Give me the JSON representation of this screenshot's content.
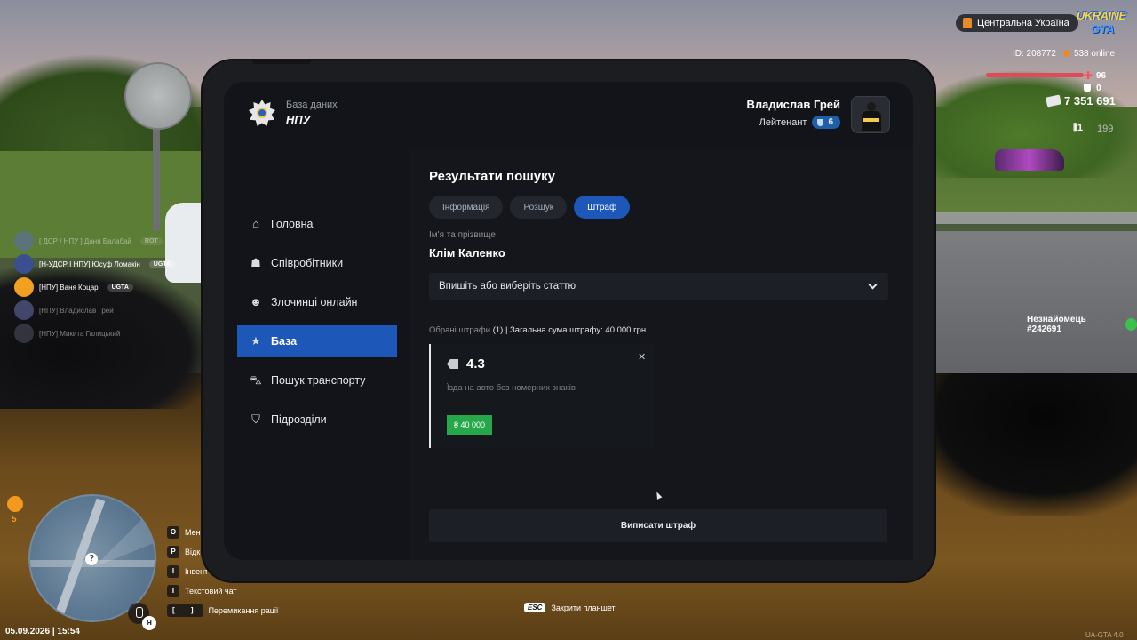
{
  "hud": {
    "region": "Центральна Україна",
    "logo_line1": "UKRAINE",
    "logo_line2": "GTA",
    "player_id": "ID: 208772",
    "online": "538 online",
    "health": "96",
    "armor": "0",
    "money": "7 351 691",
    "ammo_mag": "1",
    "ammo_total": "199",
    "stranger": "Незнайомець #242691",
    "hunger": "5",
    "datetime": "05.09.2026 | 15:54",
    "lang": "Я",
    "version": "UA-GTA 4.0"
  },
  "chat": [
    {
      "text": "[ ДСР / НПУ ] Даня Балабай",
      "badge": "ROT",
      "faded": true
    },
    {
      "text": "[Н-УДСР І НПУ] Юсуф Ломакін",
      "badge": "UGTA",
      "faded": false
    },
    {
      "text": "[НПУ] Ваня Коцар",
      "badge": "UGTA",
      "faded": false
    },
    {
      "text": "[НПУ] Владислав Грей",
      "badge": "",
      "faded": true
    },
    {
      "text": "[НПУ] Микита Галицький",
      "badge": "",
      "faded": true
    }
  ],
  "hotkeys": [
    {
      "key": "O",
      "label": "Мен"
    },
    {
      "key": "P",
      "label": "Відк"
    },
    {
      "key": "I",
      "label": "Інвент"
    },
    {
      "key": "T",
      "label": "Текстовий чат"
    },
    {
      "key": "[ ]",
      "label": "Перемикання рації"
    }
  ],
  "esc_hint": {
    "key": "ESC",
    "label": "Закрити планшет"
  },
  "tablet": {
    "brand_sub": "База даних",
    "brand_title": "НПУ",
    "user_name": "Владислав Грей",
    "user_rank": "Лейтенант",
    "user_rank_level": "6",
    "nav": [
      {
        "label": "Головна",
        "icon": "home-icon",
        "active": false
      },
      {
        "label": "Співробітники",
        "icon": "users-icon",
        "active": false
      },
      {
        "label": "Злочинці онлайн",
        "icon": "criminal-icon",
        "active": false
      },
      {
        "label": "База",
        "icon": "star-icon",
        "active": true
      },
      {
        "label": "Пошук транспорту",
        "icon": "car-icon",
        "active": false
      },
      {
        "label": "Підрозділи",
        "icon": "shield-icon",
        "active": false
      }
    ],
    "section_title": "Результати пошуку",
    "tabs": [
      {
        "label": "Інформація",
        "active": false
      },
      {
        "label": "Розшук",
        "active": false
      },
      {
        "label": "Штраф",
        "active": true
      }
    ],
    "name_label": "Ім'я та прізвище",
    "person_name": "Клім Каленко",
    "article_select": "Впишіть або виберіть статтю",
    "summary_muted": "Обрані штрафи",
    "summary_rest": " (1) | Загальна сума штрафу: 40 000 грн",
    "fine": {
      "code": "4.3",
      "description": "Їзда на авто без номерних знаків",
      "amount": "₴ 40 000"
    },
    "issue_button": "Виписати штраф"
  },
  "colors": {
    "accent": "#1d57b7",
    "fine_green": "#26a74a",
    "panel_bg": "#121419"
  }
}
